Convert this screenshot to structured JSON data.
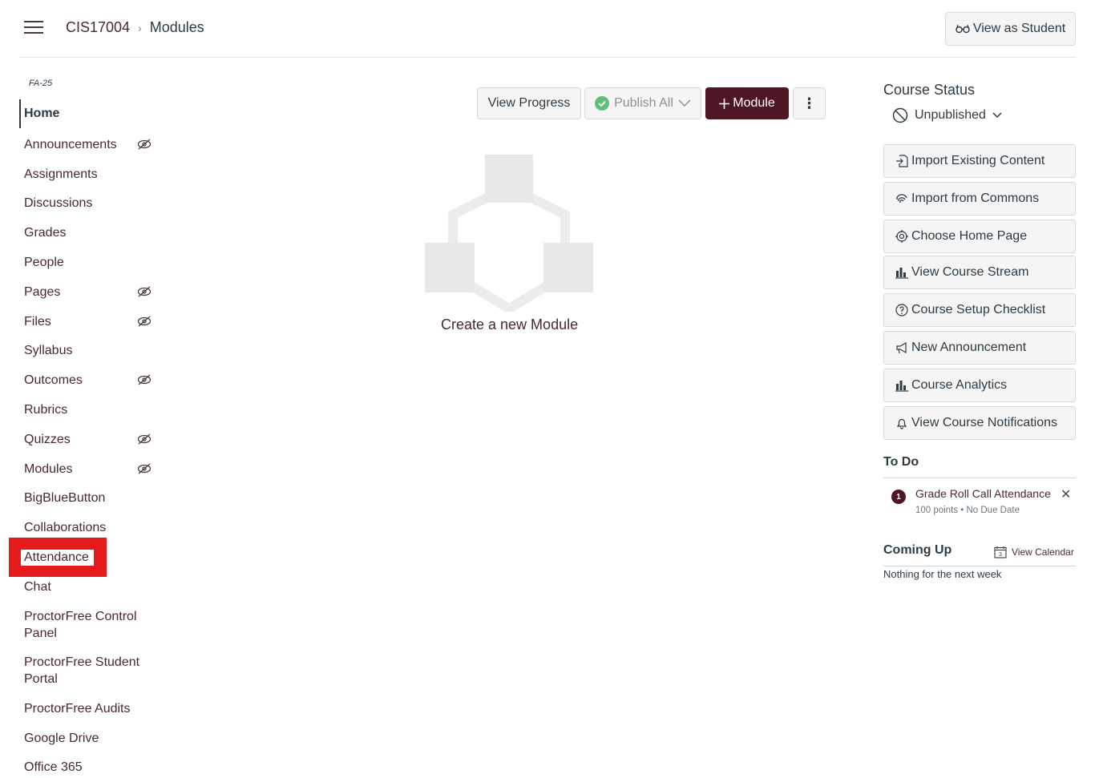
{
  "header": {
    "course_code": "CIS17004",
    "separator": ">",
    "current_page": "Modules",
    "view_as_student": "View as Student"
  },
  "sidebar": {
    "term": "FA-25",
    "items": [
      {
        "label": "Home",
        "hidden": false
      },
      {
        "label": "Announcements",
        "hidden": true
      },
      {
        "label": "Assignments",
        "hidden": false
      },
      {
        "label": "Discussions",
        "hidden": false
      },
      {
        "label": "Grades",
        "hidden": false
      },
      {
        "label": "People",
        "hidden": false
      },
      {
        "label": "Pages",
        "hidden": true
      },
      {
        "label": "Files",
        "hidden": true
      },
      {
        "label": "Syllabus",
        "hidden": false
      },
      {
        "label": "Outcomes",
        "hidden": true
      },
      {
        "label": "Rubrics",
        "hidden": false
      },
      {
        "label": "Quizzes",
        "hidden": true
      },
      {
        "label": "Modules",
        "hidden": true
      },
      {
        "label": "BigBlueButton",
        "hidden": false
      },
      {
        "label": "Collaborations",
        "hidden": false
      },
      {
        "label": "Attendance",
        "hidden": false,
        "highlighted": true
      },
      {
        "label": "Chat",
        "hidden": false
      },
      {
        "label": "ProctorFree Control Panel",
        "hidden": false
      },
      {
        "label": "ProctorFree Student Portal",
        "hidden": false
      },
      {
        "label": "ProctorFree Audits",
        "hidden": false
      },
      {
        "label": "Google Drive",
        "hidden": false
      },
      {
        "label": "Office 365",
        "hidden": false
      }
    ],
    "hidden_icon": "eye-slash-icon",
    "highlight_color": "#e61c1c"
  },
  "toolbar": {
    "view_progress": "View Progress",
    "publish_all": "Publish All",
    "module": "Module",
    "more": "⋮"
  },
  "empty_state": {
    "text": "Create a new Module"
  },
  "course_status": {
    "title": "Course Status",
    "status": "Unpublished"
  },
  "actions": [
    {
      "label": "Import Existing Content",
      "icon": "import-icon"
    },
    {
      "label": "Import from Commons",
      "icon": "commons-icon"
    },
    {
      "label": "Choose Home Page",
      "icon": "target-icon"
    },
    {
      "label": "View Course Stream",
      "icon": "bar-chart-icon"
    },
    {
      "label": "Course Setup Checklist",
      "icon": "question-icon"
    },
    {
      "label": "New Announcement",
      "icon": "megaphone-icon"
    },
    {
      "label": "Course Analytics",
      "icon": "bar-chart-icon"
    },
    {
      "label": "View Course Notifications",
      "icon": "bell-icon"
    }
  ],
  "todo": {
    "heading": "To Do",
    "items": [
      {
        "count": "1",
        "title": "Grade Roll Call Attendance",
        "meta": "100 points • No Due Date"
      }
    ]
  },
  "coming_up": {
    "heading": "Coming Up",
    "view_calendar": "View Calendar",
    "calendar_day": "3",
    "empty": "Nothing for the next week"
  },
  "colors": {
    "brand": "#4f1723",
    "link": "#4a2833",
    "publish_check": "#5fbf7a"
  }
}
